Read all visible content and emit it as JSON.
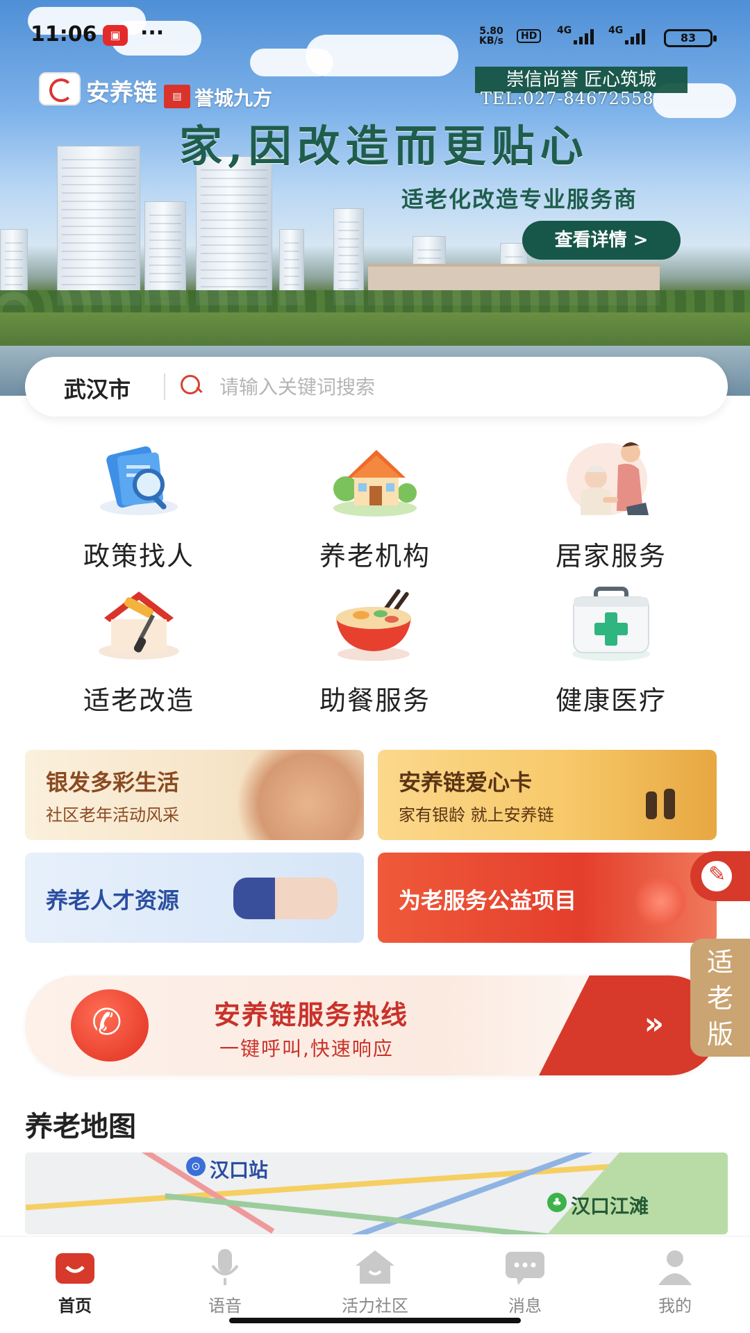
{
  "status_bar": {
    "time": "11:06",
    "dots": "···",
    "net_speed_value": "5.80",
    "net_speed_unit": "KB/s",
    "hd": "HD",
    "sig1": "4G",
    "sig2": "4G",
    "battery": "83"
  },
  "banner": {
    "brand": "安养链",
    "partner": "誉城九方",
    "slogan": "崇信尚誉 匠心筑城",
    "tel": "TEL:027-84672558",
    "headline": "家,因改造而更贴心",
    "subline": "适老化改造专业服务商",
    "button": "查看详情 >"
  },
  "search": {
    "city": "武汉市",
    "placeholder": "请输入关键词搜索"
  },
  "services": [
    {
      "label": "政策找人",
      "icon": "document-search-icon"
    },
    {
      "label": "养老机构",
      "icon": "house-icon"
    },
    {
      "label": "居家服务",
      "icon": "caregiver-icon"
    },
    {
      "label": "适老改造",
      "icon": "paint-roller-icon"
    },
    {
      "label": "助餐服务",
      "icon": "noodle-bowl-icon"
    },
    {
      "label": "健康医疗",
      "icon": "medical-kit-icon"
    }
  ],
  "promos": [
    {
      "title": "银发多彩生活",
      "subtitle": "社区老年活动风采"
    },
    {
      "title": "安养链爱心卡",
      "subtitle": "家有银龄 就上安养链"
    },
    {
      "title": "养老人才资源",
      "subtitle": ""
    },
    {
      "title": "为老服务公益项目",
      "subtitle": ""
    }
  ],
  "hotline": {
    "title": "安养链服务热线",
    "subtitle": "一键呼叫,快速响应",
    "arrow": "»"
  },
  "elder_mode": {
    "label": "适老版"
  },
  "map": {
    "title": "养老地图",
    "labels": [
      "汉口站",
      "汉口江滩"
    ]
  },
  "nav": [
    {
      "label": "首页",
      "icon": "home-icon",
      "active": true
    },
    {
      "label": "语音",
      "icon": "microphone-icon",
      "active": false
    },
    {
      "label": "活力社区",
      "icon": "community-house-icon",
      "active": false
    },
    {
      "label": "消息",
      "icon": "chat-bubble-icon",
      "active": false
    },
    {
      "label": "我的",
      "icon": "user-icon",
      "active": false
    }
  ],
  "colors": {
    "accent": "#d73a2a",
    "banner_green": "#17574a",
    "elder_tab": "#caa472"
  }
}
